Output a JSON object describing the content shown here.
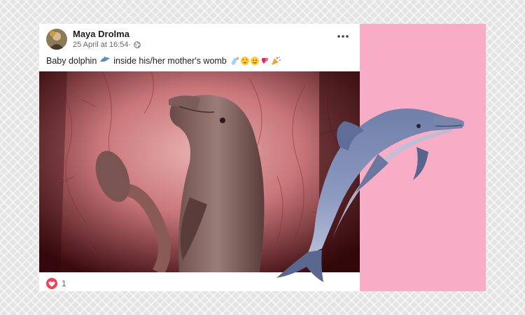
{
  "post": {
    "author_name": "Maya Drolma",
    "timestamp": "25 April at 16:54",
    "privacy_icon": "globe-icon",
    "caption_before_emoji": "Baby dolphin",
    "caption_after_emoji": "inside his/her mother's womb",
    "caption_emojis": [
      "dolphin-emoji",
      "baby-bottle-emoji",
      "heart-eyes-emoji",
      "smiling-emoji",
      "hearts-emoji",
      "confetti-emoji"
    ],
    "reaction_icon": "heart-reaction-icon",
    "reaction_count": "1",
    "menu_icon": "more-options-icon"
  },
  "colors": {
    "pink_panel": "#f9acc6",
    "background": "#e4e4e4",
    "reaction_heart": "#f33e58",
    "meta_text": "#65676b"
  }
}
